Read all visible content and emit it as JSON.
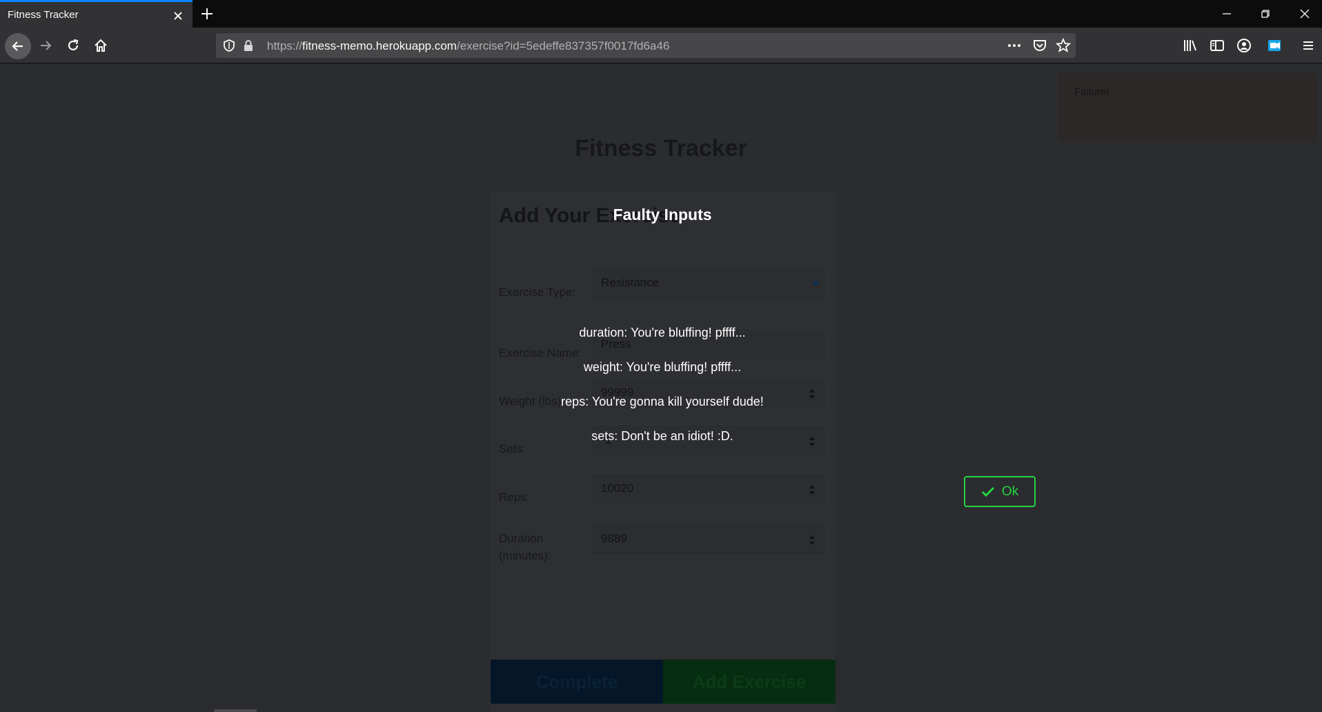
{
  "browser": {
    "tab_title": "Fitness Tracker",
    "url_prefix": "https://",
    "url_host": "fitness-memo.herokuapp.com",
    "url_path": "/exercise?id=5edeffe837357f0017fd6a46",
    "icons": [
      "back-icon",
      "forward-icon",
      "reload-icon",
      "home-icon",
      "shield-icon",
      "lock-icon",
      "more-icon",
      "pocket-icon",
      "bookmark-star-icon",
      "library-icon",
      "sidebar-icon",
      "account-icon",
      "extension-icon",
      "menu-icon",
      "minimize-icon",
      "restore-icon",
      "close-window-icon"
    ],
    "accent": "#0a84ff"
  },
  "page": {
    "title": "Fitness Tracker",
    "toast": {
      "text": "Failure!"
    },
    "form": {
      "heading": "Add Your Exercise",
      "type_label": "Exercise Type:",
      "type_value": "Resistance",
      "name_label": "Exercise Name:",
      "name_value": "Press",
      "weight_label": "Weight (lbs):",
      "weight_value": "99999",
      "sets_label": "Sets:",
      "sets_value": "-1",
      "reps_label": "Reps:",
      "reps_value": "10020",
      "duration_label": "Duration (minutes):",
      "duration_value": "9889",
      "complete_label": "Complete",
      "add_label": "Add Exercise"
    }
  },
  "modal": {
    "title": "Faulty Inputs",
    "errors": [
      "duration: You're bluffing! pffff...",
      "weight: You're bluffing! pffff...",
      "reps: You're gonna kill yourself dude!",
      "sets: Don't be an idiot! :D."
    ],
    "ok_label": "Ok",
    "ok_color": "#24d441"
  }
}
